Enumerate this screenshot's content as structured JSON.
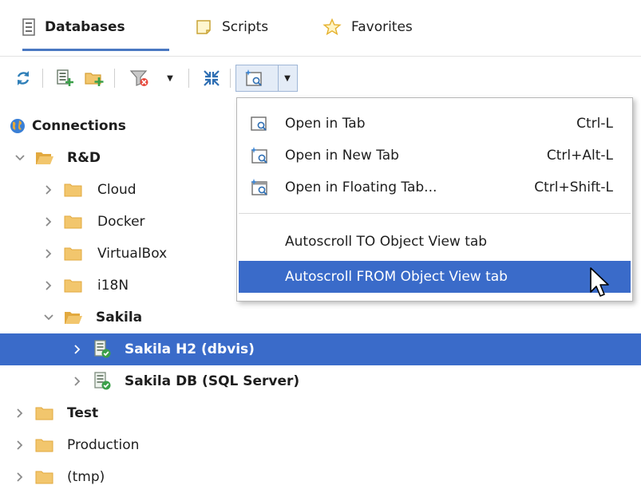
{
  "tabs": [
    {
      "label": "Databases",
      "icon": "database-list-icon",
      "active": true
    },
    {
      "label": "Scripts",
      "icon": "script-icon",
      "active": false
    },
    {
      "label": "Favorites",
      "icon": "star-icon",
      "active": false
    }
  ],
  "toolbar": {
    "buttons": [
      {
        "name": "refresh-button",
        "icon": "refresh-icon"
      },
      {
        "name": "create-connection-button",
        "icon": "add-connection-icon"
      },
      {
        "name": "create-folder-button",
        "icon": "add-folder-icon"
      },
      {
        "name": "filter-button",
        "icon": "filter-icon"
      },
      {
        "name": "collapse-all-button",
        "icon": "collapse-icon"
      },
      {
        "name": "open-object-view-button",
        "icon": "object-view-icon"
      }
    ]
  },
  "tree": {
    "root": {
      "label": "Connections",
      "icon": "globe-icon"
    },
    "items": [
      {
        "label": "R&D",
        "expanded": true,
        "bold": true,
        "type": "folder"
      },
      {
        "label": "Cloud",
        "expanded": false,
        "bold": false,
        "type": "folder"
      },
      {
        "label": "Docker",
        "expanded": false,
        "bold": false,
        "type": "folder"
      },
      {
        "label": "VirtualBox",
        "expanded": false,
        "bold": false,
        "type": "folder"
      },
      {
        "label": "i18N",
        "expanded": false,
        "bold": false,
        "type": "folder"
      },
      {
        "label": "Sakila",
        "expanded": true,
        "bold": true,
        "type": "folder"
      },
      {
        "label": "Sakila H2 (dbvis)",
        "expanded": false,
        "bold": true,
        "type": "connection",
        "selected": true
      },
      {
        "label": "Sakila DB (SQL Server)",
        "expanded": false,
        "bold": true,
        "type": "connection"
      },
      {
        "label": "Test",
        "expanded": false,
        "bold": true,
        "type": "folder"
      },
      {
        "label": "Production",
        "expanded": false,
        "bold": false,
        "type": "folder"
      },
      {
        "label": "(tmp)",
        "expanded": false,
        "bold": false,
        "type": "folder"
      }
    ]
  },
  "menu": {
    "items": [
      {
        "label": "Open in Tab",
        "shortcut": "Ctrl-L",
        "icon": "open-tab-icon"
      },
      {
        "label": "Open in New Tab",
        "shortcut": "Ctrl+Alt-L",
        "icon": "open-new-tab-icon"
      },
      {
        "label": "Open in Floating Tab...",
        "shortcut": "Ctrl+Shift-L",
        "icon": "open-floating-tab-icon"
      },
      {
        "label": "Autoscroll TO Object View tab",
        "shortcut": "",
        "icon": ""
      },
      {
        "label": "Autoscroll FROM Object View tab",
        "shortcut": "",
        "icon": "",
        "highlighted": true
      }
    ]
  },
  "colors": {
    "accent": "#3a6bc9",
    "tab_underline": "#4a78c2",
    "folder": "#f2c66d",
    "folder_dark": "#e2a93f"
  }
}
